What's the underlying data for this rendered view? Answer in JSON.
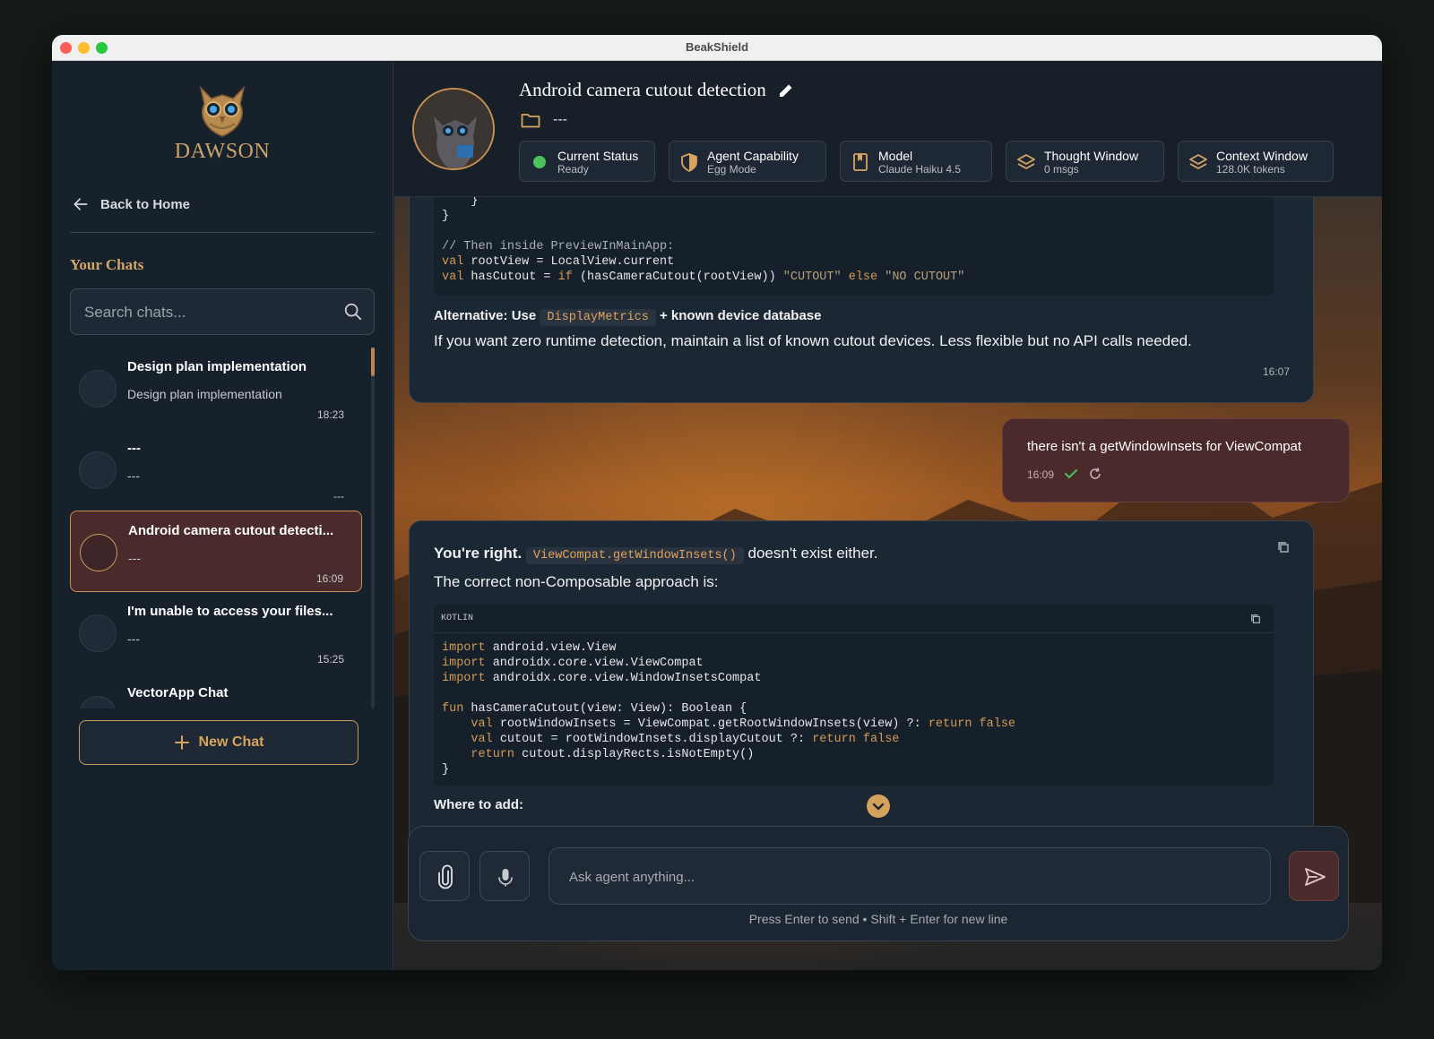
{
  "window": {
    "title": "BeakShield"
  },
  "sidebar": {
    "brand": "DAWSON",
    "back_label": "Back to Home",
    "section_title": "Your Chats",
    "search_placeholder": "Search chats...",
    "chats": [
      {
        "name": "Design plan implementation",
        "preview": "Design plan implementation",
        "time": "18:23",
        "active": false
      },
      {
        "name": "---",
        "preview": "---",
        "time": "---",
        "active": false
      },
      {
        "name": "Android camera cutout detecti...",
        "preview": "---",
        "time": "16:09",
        "active": true
      },
      {
        "name": "I'm unable to access your files...",
        "preview": "---",
        "time": "15:25",
        "active": false
      },
      {
        "name": "VectorApp Chat",
        "preview": "",
        "time": "",
        "active": false
      }
    ],
    "new_chat_label": "New Chat"
  },
  "header": {
    "title": "Android camera cutout detection",
    "folder": "---",
    "stats": [
      {
        "label": "Current Status",
        "value": "Ready",
        "icon": "status-dot-icon"
      },
      {
        "label": "Agent Capability",
        "value": "Egg Mode",
        "icon": "shield-icon"
      },
      {
        "label": "Model",
        "value": "Claude Haiku 4.5",
        "icon": "bookmark-icon"
      },
      {
        "label": "Thought Window",
        "value": "0 msgs",
        "icon": "layers-icon"
      },
      {
        "label": "Context Window",
        "value": "128.0K tokens",
        "icon": "layers-icon"
      }
    ]
  },
  "messages": {
    "first": {
      "code_lines": [
        "    }",
        "}",
        "",
        "// Then inside PreviewInMainApp:",
        "val rootView = LocalView.current",
        "val hasCutout = if (hasCameraCutout(rootView)) \"CUTOUT\" else \"NO CUTOUT\""
      ],
      "alt_prefix": "Alternative: Use",
      "alt_code": "DisplayMetrics",
      "alt_suffix": "+ known device database",
      "paragraph": "If you want zero runtime detection, maintain a list of known cutout devices. Less flexible but no API calls needed.",
      "time": "16:07"
    },
    "user": {
      "text": "there isn't a getWindowInsets for ViewCompat",
      "time": "16:09"
    },
    "second": {
      "lead": "You're right.",
      "code_inline": "ViewCompat.getWindowInsets()",
      "lead_suffix": "doesn't exist either.",
      "line2": "The correct non-Composable approach is:",
      "code_lang": "KOTLIN",
      "code_lines": [
        "import android.view.View",
        "import androidx.core.view.ViewCompat",
        "import androidx.core.view.WindowInsetsCompat",
        "",
        "fun hasCameraCutout(view: View): Boolean {",
        "    val rootWindowInsets = ViewCompat.getRootWindowInsets(view) ?: return false",
        "    val cutout = rootWindowInsets.displayCutout ?: return false",
        "    return cutout.displayRects.isNotEmpty()",
        "}"
      ],
      "where": "Where to add:"
    }
  },
  "composer": {
    "placeholder": "Ask agent anything...",
    "hint": "Press Enter to send • Shift + Enter for new line"
  },
  "colors": {
    "accent": "#c8904f",
    "status_ready": "#4cc25a",
    "active_chat_bg": "#4a2a2b"
  }
}
